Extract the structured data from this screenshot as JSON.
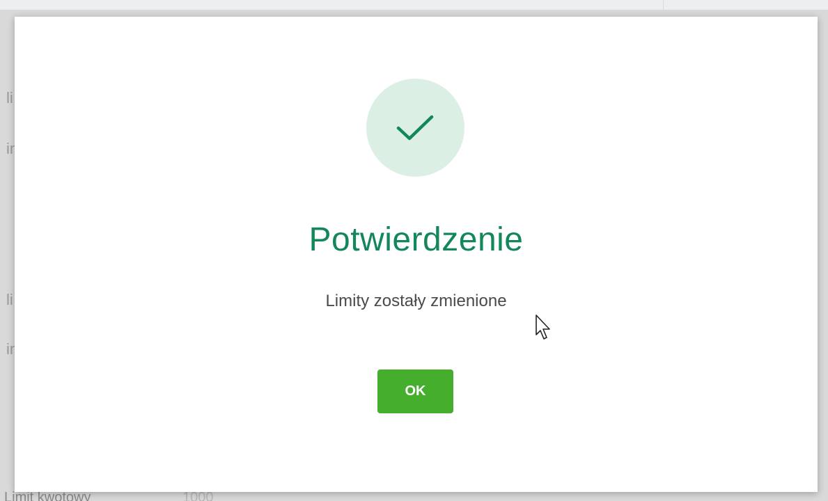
{
  "background": {
    "fragments": [
      "li",
      "in",
      "li",
      "in"
    ],
    "bottom_label": "Limit kwotowy",
    "bottom_value": "1000"
  },
  "dialog": {
    "icon": "checkmark-icon",
    "title": "Potwierdzenie",
    "message": "Limity zostały zmienione",
    "ok_label": "OK"
  },
  "colors": {
    "title": "#14875a",
    "icon_bg": "#dcefe4",
    "check": "#14875a",
    "button_bg": "#45ae2d"
  }
}
